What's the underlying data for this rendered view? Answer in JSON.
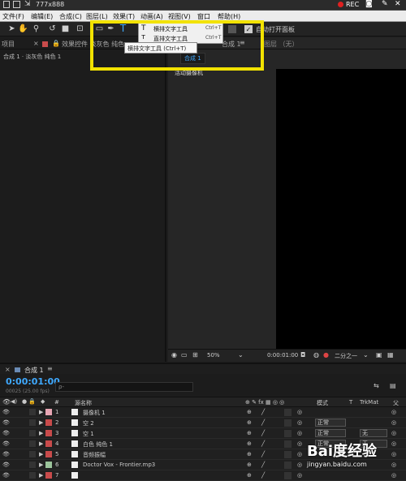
{
  "topbar": {
    "title": "777x888",
    "rec": "REC"
  },
  "menu": [
    "文件(F)",
    "编辑(E)",
    "合成(C)",
    "图层(L)",
    "效果(T)",
    "动画(A)",
    "视图(V)",
    "窗口",
    "帮助(H)"
  ],
  "popup": {
    "item1": "横排文字工具",
    "item1_shortcut": "Ctrl+T",
    "item2": "直排文字工具",
    "item2_shortcut": "Ctrl+T"
  },
  "tooltip": "横排文字工具 (Ctrl+T)",
  "toolbar": {
    "auto_open": "自动打开面板"
  },
  "left_panel": {
    "tab_project": "项目",
    "tab_effects": "效果控件 淡灰色 纯色",
    "breadcrumb": "合成 1 · 淡灰色 纯色 1"
  },
  "comp_panel": {
    "tab": "合成 1",
    "layer_tab": "图层 （无）",
    "comp_label": "合成 1",
    "camera_label": "活动摄像机"
  },
  "viewer_bar": {
    "zoom": "50%",
    "time": "0:00:01:00",
    "resolution": "二分之一"
  },
  "timeline": {
    "tab": "合成 1",
    "timecode": "0:00:01:00",
    "timecode_sub": "00025 (25.00 fps)",
    "search_placeholder": "ρ-",
    "col_hash": "#",
    "col_source": "源名称",
    "col_mode": "模式",
    "col_t": "T",
    "col_trkmat": "TrkMat",
    "col_parent": "父"
  },
  "layers": [
    {
      "num": "1",
      "name": "摄像机 1",
      "color": "#e8a6b4",
      "mode": "",
      "trk": ""
    },
    {
      "num": "2",
      "name": "空 2",
      "color": "#c84b4b",
      "mode": "正常",
      "trk": ""
    },
    {
      "num": "3",
      "name": "空 1",
      "color": "#c84b4b",
      "mode": "正常",
      "trk": "无"
    },
    {
      "num": "4",
      "name": "白色 纯色 1",
      "color": "#c84b4b",
      "mode": "正常",
      "trk": "无"
    },
    {
      "num": "5",
      "name": "音频振幅",
      "color": "#c84b4b",
      "mode": "",
      "trk": ""
    },
    {
      "num": "6",
      "name": "Doctor Vox - Frontier.mp3",
      "color": "#9bc49b",
      "mode": "",
      "trk": ""
    },
    {
      "num": "7",
      "name": "",
      "color": "#c84b4b",
      "mode": "",
      "trk": ""
    }
  ],
  "watermark": {
    "text": "Bai度经验",
    "url": "jingyan.baidu.com"
  }
}
